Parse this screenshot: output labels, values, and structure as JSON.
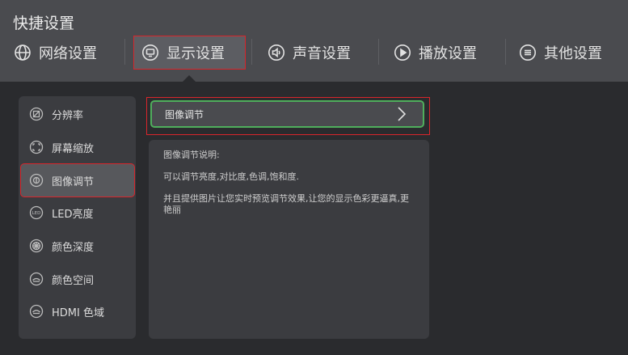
{
  "app": {
    "title": "快捷设置"
  },
  "tabs": [
    {
      "label": "网络设置",
      "icon": "globe-icon"
    },
    {
      "label": "显示设置",
      "icon": "monitor-icon",
      "active": true
    },
    {
      "label": "声音设置",
      "icon": "speaker-icon"
    },
    {
      "label": "播放设置",
      "icon": "play-icon"
    },
    {
      "label": "其他设置",
      "icon": "menu-icon"
    }
  ],
  "sidebar": {
    "items": [
      {
        "label": "分辨率",
        "icon": "resolution-icon"
      },
      {
        "label": "屏幕缩放",
        "icon": "screen-scale-icon"
      },
      {
        "label": "图像调节",
        "icon": "image-adjust-icon",
        "active": true
      },
      {
        "label": "LED亮度",
        "icon": "led-brightness-icon"
      },
      {
        "label": "颜色深度",
        "icon": "color-depth-icon"
      },
      {
        "label": "颜色空间",
        "icon": "color-space-icon"
      },
      {
        "label": "HDMI 色域",
        "icon": "hdmi-gamut-icon"
      }
    ]
  },
  "detail": {
    "row_label": "图像调节",
    "description_title": "图像调节说明:",
    "description_lines": [
      "可以调节亮度,对比度,色调,饱和度.",
      "并且提供图片让您实时预览调节效果,让您的显示色彩更逼真,更艳丽"
    ]
  },
  "colors": {
    "highlight_red": "#d9252b",
    "focus_green": "#4fae5c",
    "topbar_bg": "#4a4b4f",
    "page_bg": "#2a2b2e"
  }
}
